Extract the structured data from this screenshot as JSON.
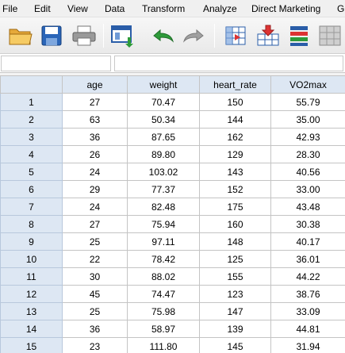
{
  "menu": {
    "file": "File",
    "edit": "Edit",
    "view": "View",
    "data": "Data",
    "transform": "Transform",
    "analyze": "Analyze",
    "direct_marketing": "Direct Marketing",
    "graphs": "G"
  },
  "toolbar": {
    "icons": [
      "open-folder-icon",
      "save-icon",
      "print-icon",
      "recall-dialog-icon",
      "undo-icon",
      "redo-icon",
      "go-to-case-icon",
      "go-to-variable-icon",
      "variables-icon",
      "find-icon"
    ]
  },
  "editbar": {
    "cell_ref": "",
    "cell_value": ""
  },
  "colors": {
    "header_bg": "#dde7f3",
    "grid_line": "#c4c4c4",
    "undo_green": "#2e9b3a",
    "redo_gray": "#a0a0a0"
  },
  "table": {
    "columns": [
      "age",
      "weight",
      "heart_rate",
      "VO2max"
    ],
    "rows": [
      {
        "id": "1",
        "age": "27",
        "weight": "70.47",
        "heart_rate": "150",
        "vo2max": "55.79"
      },
      {
        "id": "2",
        "age": "63",
        "weight": "50.34",
        "heart_rate": "144",
        "vo2max": "35.00"
      },
      {
        "id": "3",
        "age": "36",
        "weight": "87.65",
        "heart_rate": "162",
        "vo2max": "42.93"
      },
      {
        "id": "4",
        "age": "26",
        "weight": "89.80",
        "heart_rate": "129",
        "vo2max": "28.30"
      },
      {
        "id": "5",
        "age": "24",
        "weight": "103.02",
        "heart_rate": "143",
        "vo2max": "40.56"
      },
      {
        "id": "6",
        "age": "29",
        "weight": "77.37",
        "heart_rate": "152",
        "vo2max": "33.00"
      },
      {
        "id": "7",
        "age": "24",
        "weight": "82.48",
        "heart_rate": "175",
        "vo2max": "43.48"
      },
      {
        "id": "8",
        "age": "27",
        "weight": "75.94",
        "heart_rate": "160",
        "vo2max": "30.38"
      },
      {
        "id": "9",
        "age": "25",
        "weight": "97.11",
        "heart_rate": "148",
        "vo2max": "40.17"
      },
      {
        "id": "10",
        "age": "22",
        "weight": "78.42",
        "heart_rate": "125",
        "vo2max": "36.01"
      },
      {
        "id": "11",
        "age": "30",
        "weight": "88.02",
        "heart_rate": "155",
        "vo2max": "44.22"
      },
      {
        "id": "12",
        "age": "45",
        "weight": "74.47",
        "heart_rate": "123",
        "vo2max": "38.76"
      },
      {
        "id": "13",
        "age": "25",
        "weight": "75.98",
        "heart_rate": "147",
        "vo2max": "33.09"
      },
      {
        "id": "14",
        "age": "36",
        "weight": "58.97",
        "heart_rate": "139",
        "vo2max": "44.81"
      },
      {
        "id": "15",
        "age": "23",
        "weight": "111.80",
        "heart_rate": "145",
        "vo2max": "31.94"
      }
    ]
  }
}
